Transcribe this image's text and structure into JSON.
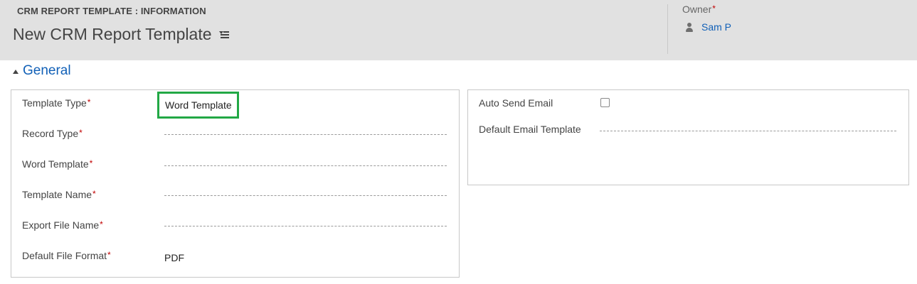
{
  "header": {
    "entity_label": "CRM REPORT TEMPLATE : INFORMATION",
    "record_title": "New CRM Report Template",
    "owner": {
      "label": "Owner",
      "required_marker": "*",
      "value": "Sam P"
    }
  },
  "section": {
    "title": "General"
  },
  "left_panel": {
    "fields": [
      {
        "label": "Template Type",
        "required": "*",
        "value": "Word Template"
      },
      {
        "label": "Record Type",
        "required": "*",
        "value": ""
      },
      {
        "label": "Word Template",
        "required": "*",
        "value": ""
      },
      {
        "label": "Template Name",
        "required": "*",
        "value": ""
      },
      {
        "label": "Export File Name",
        "required": "*",
        "value": ""
      },
      {
        "label": "Default File Format",
        "required": "*",
        "value": "PDF"
      }
    ]
  },
  "right_panel": {
    "fields": [
      {
        "label": "Auto Send Email",
        "checked": false
      },
      {
        "label": "Default Email Template",
        "value": ""
      }
    ]
  },
  "colors": {
    "header_background": "#e1e1e1",
    "link": "#1160b7",
    "required": "#c00000",
    "highlight": "#22a845"
  },
  "icons": [
    "menu-icon",
    "person-icon",
    "collapse-triangle-icon"
  ]
}
